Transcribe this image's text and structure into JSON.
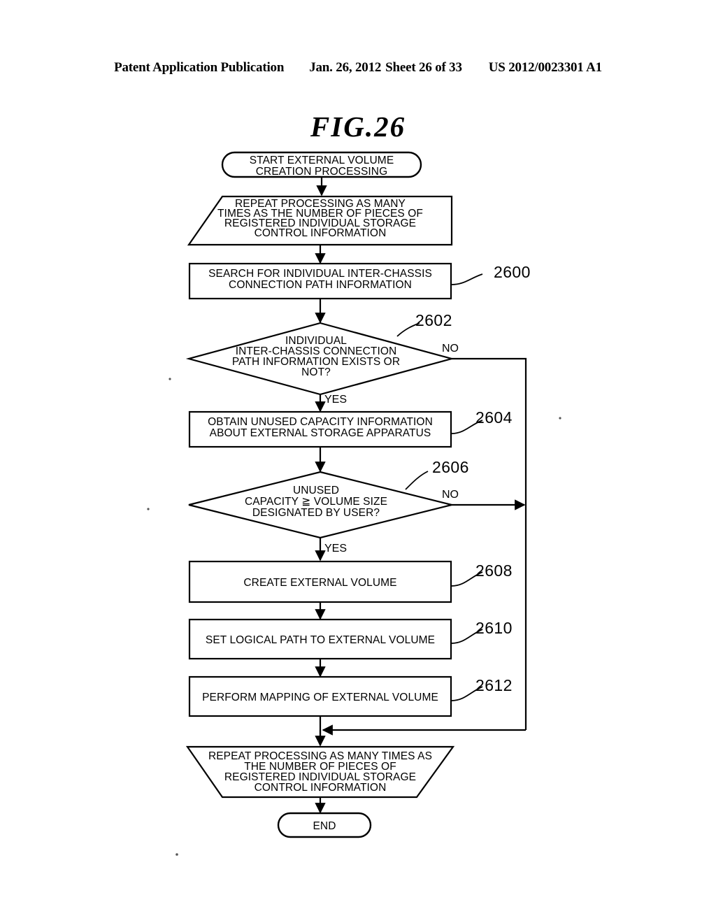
{
  "header": {
    "publication": "Patent Application Publication",
    "date": "Jan. 26, 2012",
    "sheet": "Sheet 26 of 33",
    "document_number": "US 2012/0023301 A1"
  },
  "figure": {
    "title": "FIG.26"
  },
  "flowchart": {
    "start": {
      "line1": "START EXTERNAL VOLUME",
      "line2": "CREATION PROCESSING"
    },
    "loop_begin": {
      "line1": "REPEAT PROCESSING AS MANY",
      "line2": "TIMES AS THE NUMBER OF PIECES OF",
      "line3": "REGISTERED INDIVIDUAL STORAGE",
      "line4": "CONTROL INFORMATION"
    },
    "step_2600": {
      "ref": "2600",
      "line1": "SEARCH FOR INDIVIDUAL INTER-CHASSIS",
      "line2": "CONNECTION PATH INFORMATION"
    },
    "decision_2602": {
      "ref": "2602",
      "line1": "INDIVIDUAL",
      "line2": "INTER-CHASSIS CONNECTION",
      "line3": "PATH INFORMATION EXISTS OR",
      "line4": "NOT?",
      "yes_label": "YES",
      "no_label": "NO"
    },
    "step_2604": {
      "ref": "2604",
      "line1": "OBTAIN UNUSED CAPACITY INFORMATION",
      "line2": "ABOUT EXTERNAL STORAGE APPARATUS"
    },
    "decision_2606": {
      "ref": "2606",
      "line1": "UNUSED",
      "line2": "CAPACITY ≧ VOLUME SIZE",
      "line3": "DESIGNATED BY USER?",
      "yes_label": "YES",
      "no_label": "NO"
    },
    "step_2608": {
      "ref": "2608",
      "line1": "CREATE EXTERNAL VOLUME"
    },
    "step_2610": {
      "ref": "2610",
      "line1": "SET LOGICAL PATH TO EXTERNAL VOLUME"
    },
    "step_2612": {
      "ref": "2612",
      "line1": "PERFORM MAPPING OF EXTERNAL VOLUME"
    },
    "loop_end": {
      "line1": "REPEAT PROCESSING AS MANY TIMES AS",
      "line2": "THE NUMBER OF PIECES OF",
      "line3": "REGISTERED INDIVIDUAL STORAGE",
      "line4": "CONTROL INFORMATION"
    },
    "end": {
      "line1": "END"
    }
  }
}
